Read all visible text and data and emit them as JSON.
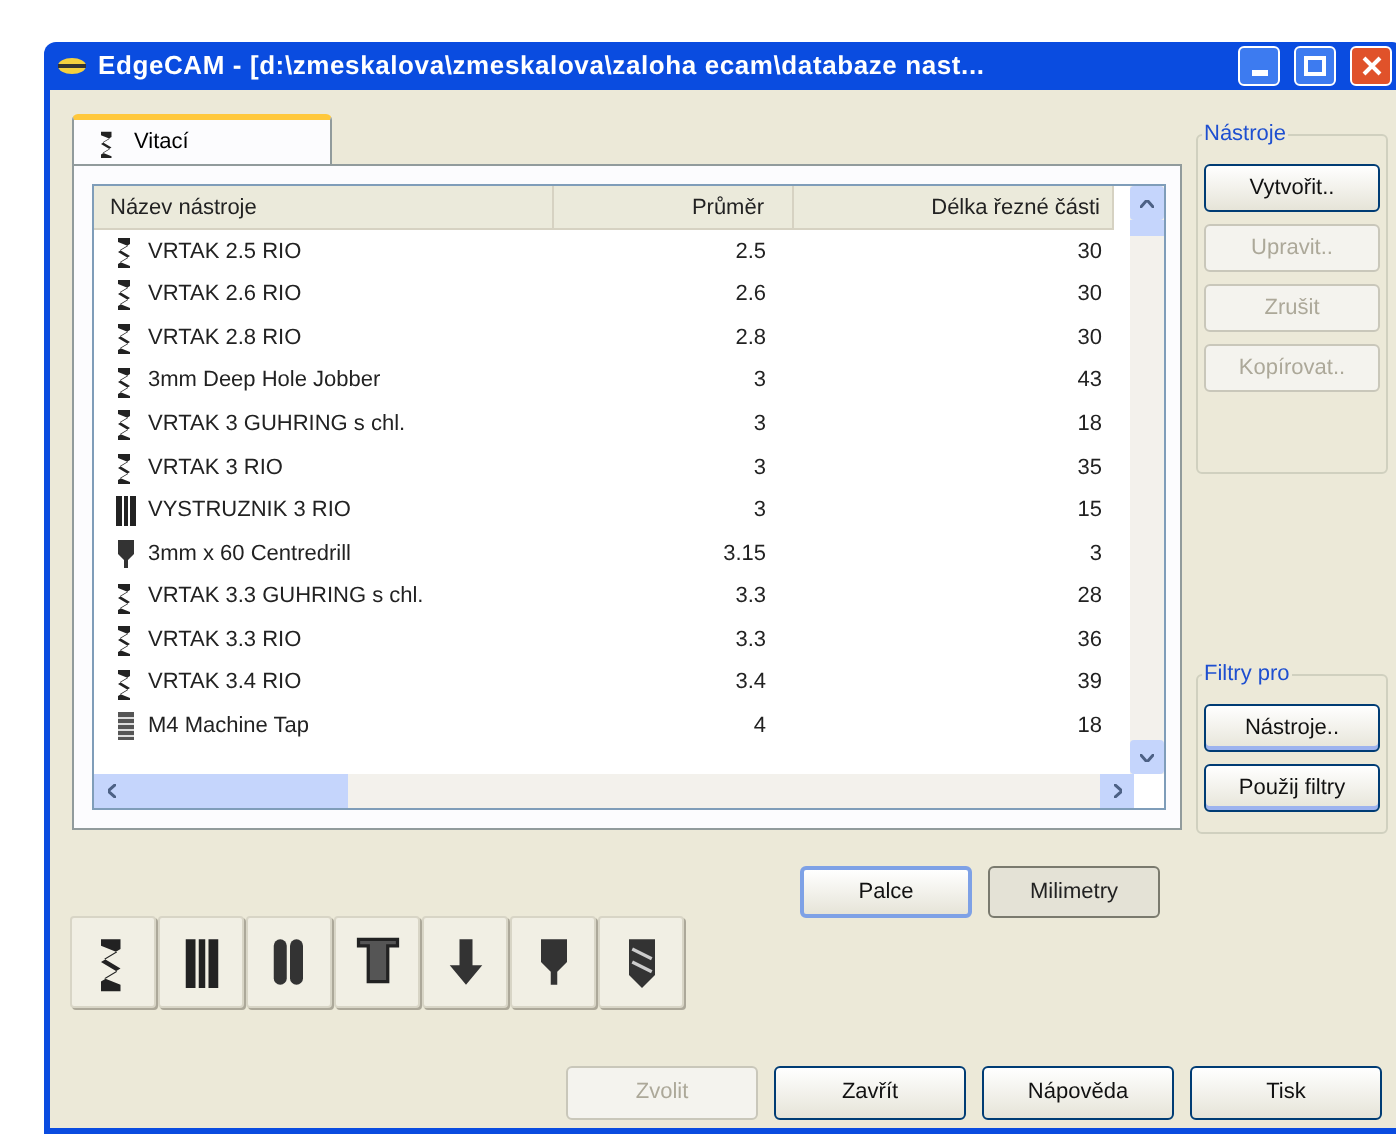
{
  "window": {
    "title": "EdgeCAM - [d:\\zmeskalova\\zmeskalova\\zaloha ecam\\databaze nast..."
  },
  "tabs": [
    {
      "label": "Vitací",
      "selected": true
    }
  ],
  "table": {
    "columns": [
      "Název nástroje",
      "Průměr",
      "Délka řezné části"
    ],
    "rows": [
      {
        "kind": "drill",
        "cells": [
          "VRTAK 2.5 RIO",
          "2.5",
          "30"
        ]
      },
      {
        "kind": "drill",
        "cells": [
          "VRTAK 2.6 RIO",
          "2.6",
          "30"
        ]
      },
      {
        "kind": "drill",
        "cells": [
          "VRTAK 2.8 RIO",
          "2.8",
          "30"
        ]
      },
      {
        "kind": "drill",
        "cells": [
          "3mm Deep Hole Jobber",
          "3",
          "43"
        ]
      },
      {
        "kind": "drill",
        "cells": [
          "VRTAK 3 GUHRING s chl.",
          "3",
          "18"
        ]
      },
      {
        "kind": "drill",
        "cells": [
          "VRTAK 3 RIO",
          "3",
          "35"
        ]
      },
      {
        "kind": "reamer",
        "cells": [
          "VYSTRUZNIK 3 RIO",
          "3",
          "15"
        ]
      },
      {
        "kind": "centre",
        "cells": [
          "3mm x 60 Centredrill",
          "3.15",
          "3"
        ]
      },
      {
        "kind": "drill",
        "cells": [
          "VRTAK 3.3 GUHRING s chl.",
          "3.3",
          "28"
        ]
      },
      {
        "kind": "drill",
        "cells": [
          "VRTAK 3.3 RIO",
          "3.3",
          "36"
        ]
      },
      {
        "kind": "drill",
        "cells": [
          "VRTAK 3.4 RIO",
          "3.4",
          "39"
        ]
      },
      {
        "kind": "tap",
        "cells": [
          "M4 Machine Tap",
          "4",
          "18"
        ]
      }
    ]
  },
  "tools_group": {
    "title": "Nástroje",
    "buttons": [
      {
        "label": "Vytvořit..",
        "disabled": false
      },
      {
        "label": "Upravit..",
        "disabled": true
      },
      {
        "label": "Zrušit",
        "disabled": true
      },
      {
        "label": "Kopírovat..",
        "disabled": true
      }
    ]
  },
  "filter_group": {
    "title": "Filtry pro",
    "buttons": [
      {
        "label": "Nástroje..",
        "disabled": false
      },
      {
        "label": "Použij filtry",
        "disabled": false
      }
    ]
  },
  "tool_type_buttons": [
    {
      "kind": "drill"
    },
    {
      "kind": "reamer"
    },
    {
      "kind": "slot"
    },
    {
      "kind": "tee"
    },
    {
      "kind": "arrow"
    },
    {
      "kind": "centre"
    },
    {
      "kind": "endmill"
    }
  ],
  "units": [
    {
      "label": "Palce",
      "selected": true
    },
    {
      "label": "Milimetry",
      "selected": false
    }
  ],
  "footer_buttons": [
    {
      "label": "Zvolit",
      "disabled": true
    },
    {
      "label": "Zavřít",
      "disabled": false
    },
    {
      "label": "Nápověda",
      "disabled": false
    },
    {
      "label": "Tisk",
      "disabled": false
    }
  ]
}
